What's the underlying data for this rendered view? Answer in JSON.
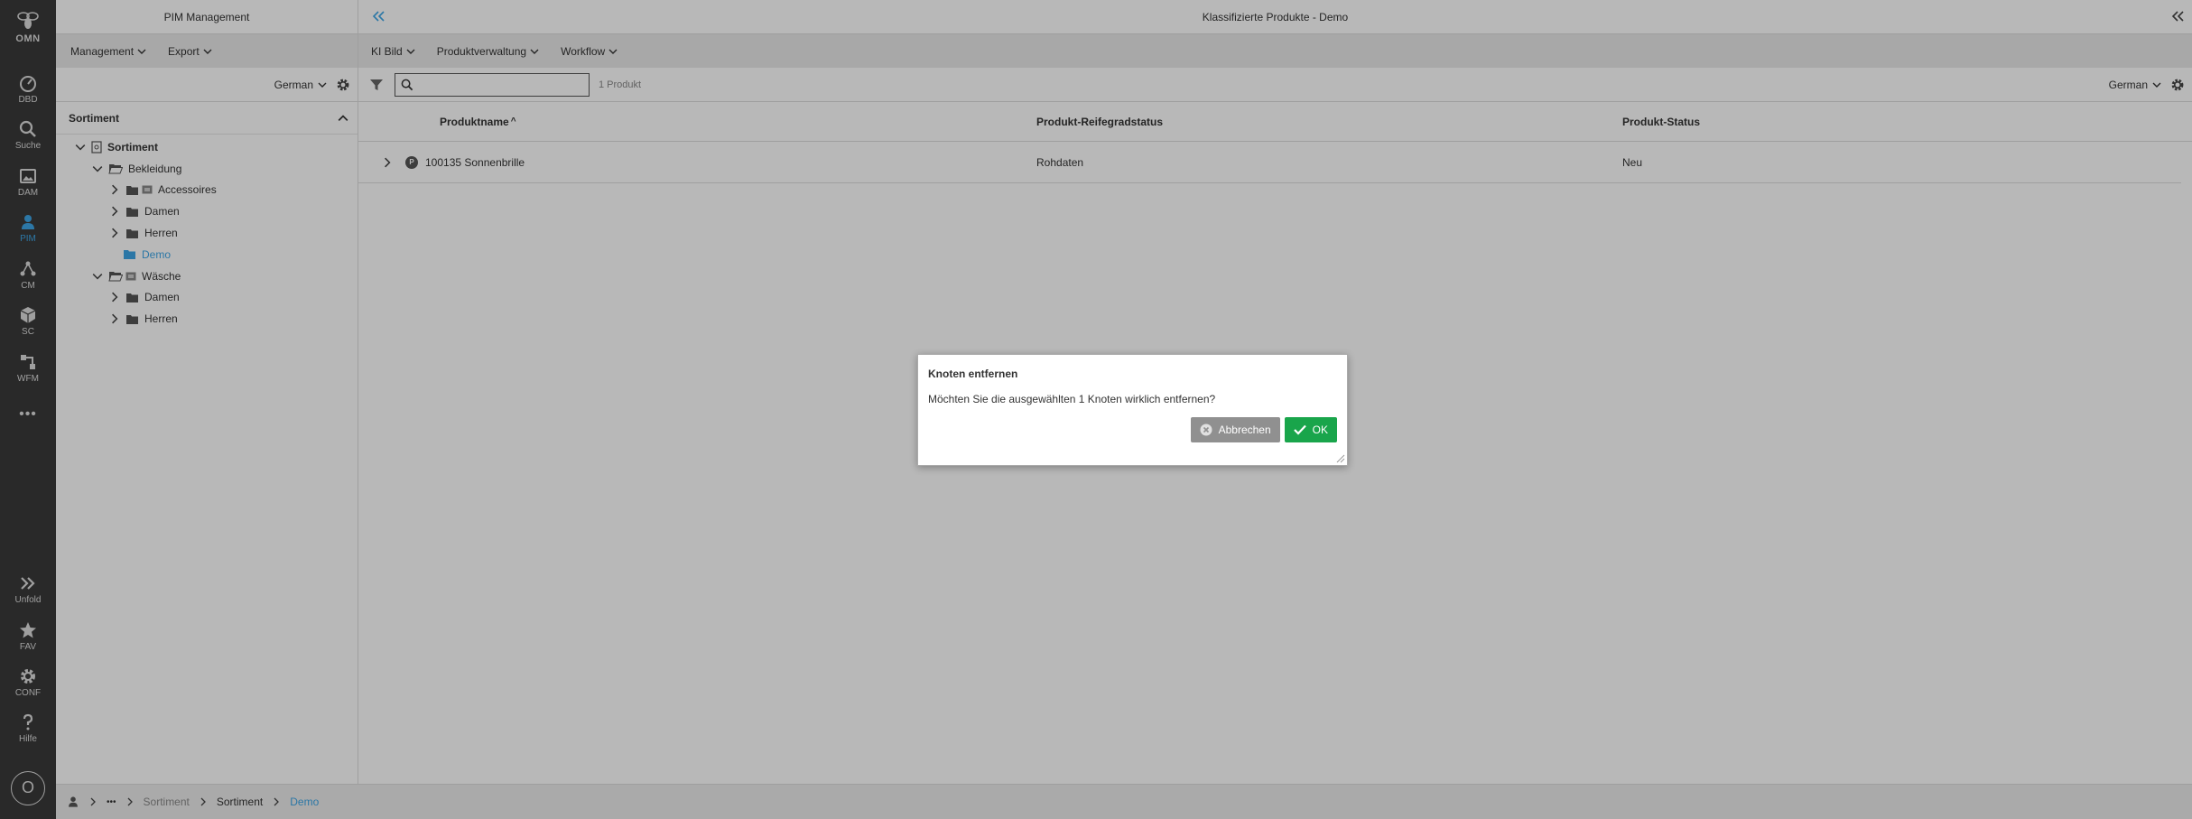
{
  "rail": {
    "logo": "OMN",
    "items": [
      {
        "label": "DBD",
        "icon": "dashboard-icon"
      },
      {
        "label": "Suche",
        "icon": "search-icon"
      },
      {
        "label": "DAM",
        "icon": "image-icon"
      },
      {
        "label": "PIM",
        "icon": "user-icon"
      },
      {
        "label": "CM",
        "icon": "network-icon"
      },
      {
        "label": "SC",
        "icon": "cube-icon"
      },
      {
        "label": "WFM",
        "icon": "workflow-icon"
      }
    ],
    "more": "•••",
    "bottom": [
      {
        "label": "Unfold",
        "icon": "double-chevron-right-icon"
      },
      {
        "label": "FAV",
        "icon": "star-icon"
      },
      {
        "label": "CONF",
        "icon": "gear-icon"
      },
      {
        "label": "Hilfe",
        "icon": "question-icon"
      }
    ],
    "avatar": "O"
  },
  "left_panel": {
    "title": "PIM Management",
    "menus": [
      "Management",
      "Export"
    ],
    "language": "German",
    "section": "Sortiment",
    "tree": [
      {
        "label": "Sortiment",
        "depth": 0,
        "expanded": true,
        "icon": "catalog"
      },
      {
        "label": "Bekleidung",
        "depth": 1,
        "expanded": true,
        "icon": "folder-open"
      },
      {
        "label": "Accessoires",
        "depth": 2,
        "expanded": false,
        "icon": "folder-tag"
      },
      {
        "label": "Damen",
        "depth": 2,
        "expanded": false,
        "icon": "folder"
      },
      {
        "label": "Herren",
        "depth": 2,
        "expanded": false,
        "icon": "folder"
      },
      {
        "label": "Demo",
        "depth": 1,
        "expanded": null,
        "icon": "folder-blue"
      },
      {
        "label": "Wäsche",
        "depth": 1,
        "expanded": true,
        "icon": "folder-open-tag"
      },
      {
        "label": "Damen",
        "depth": 2,
        "expanded": false,
        "icon": "folder"
      },
      {
        "label": "Herren",
        "depth": 2,
        "expanded": false,
        "icon": "folder"
      }
    ]
  },
  "main": {
    "title": "Klassifizierte Produkte - Demo",
    "menus": [
      "KI Bild",
      "Produktverwaltung",
      "Workflow"
    ],
    "search_placeholder": "",
    "count": "1 Produkt",
    "language": "German",
    "columns": [
      "Produktname",
      "Produkt-Reifegradstatus",
      "Produkt-Status"
    ],
    "sort_indicator": "^",
    "rows": [
      {
        "badge": "P",
        "name": "100135 Sonnenbrille",
        "maturity": "Rohdaten",
        "status": "Neu"
      }
    ]
  },
  "breadcrumb": {
    "more": "•••",
    "items": [
      "Sortiment",
      "Sortiment",
      "Demo"
    ]
  },
  "dialog": {
    "title": "Knoten entfernen",
    "message": "Möchten Sie die ausgewählten 1 Knoten wirklich entfernen?",
    "cancel_label": "Abbrechen",
    "ok_label": "OK"
  },
  "colors": {
    "accent": "#3ea6e6",
    "ok_button": "#19a54b",
    "cancel_button": "#909090",
    "rail_bg": "#3a3a3a"
  }
}
